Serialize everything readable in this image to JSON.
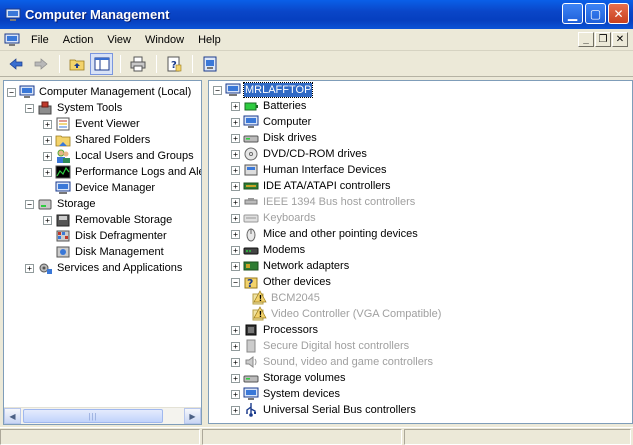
{
  "window": {
    "title": "Computer Management",
    "app_icon": "computer-management-icon",
    "controls": [
      "minimize",
      "maximize",
      "close"
    ]
  },
  "menubar": {
    "items": [
      "File",
      "Action",
      "View",
      "Window",
      "Help"
    ]
  },
  "toolbar": {
    "buttons": [
      "back-icon",
      "forward-icon",
      "up-folder-icon",
      "show-hide-tree-icon",
      "print-icon",
      "help-icon",
      "properties-icon"
    ]
  },
  "left_tree": [
    {
      "label": "Computer Management (Local)",
      "level": 0,
      "expander": "minus",
      "icon": "computer-management-icon"
    },
    {
      "label": "System Tools",
      "level": 1,
      "expander": "minus",
      "icon": "system-tools-icon"
    },
    {
      "label": "Event Viewer",
      "level": 2,
      "expander": "plus",
      "icon": "event-viewer-icon"
    },
    {
      "label": "Shared Folders",
      "level": 2,
      "expander": "plus",
      "icon": "shared-folders-icon"
    },
    {
      "label": "Local Users and Groups",
      "level": 2,
      "expander": "plus",
      "icon": "users-icon"
    },
    {
      "label": "Performance Logs and Alerts",
      "level": 2,
      "expander": "plus",
      "icon": "performance-icon"
    },
    {
      "label": "Device Manager",
      "level": 2,
      "expander": "none",
      "icon": "device-manager-icon"
    },
    {
      "label": "Storage",
      "level": 1,
      "expander": "minus",
      "icon": "storage-icon"
    },
    {
      "label": "Removable Storage",
      "level": 2,
      "expander": "plus",
      "icon": "removable-storage-icon"
    },
    {
      "label": "Disk Defragmenter",
      "level": 2,
      "expander": "none",
      "icon": "defrag-icon"
    },
    {
      "label": "Disk Management",
      "level": 2,
      "expander": "none",
      "icon": "disk-management-icon"
    },
    {
      "label": "Services and Applications",
      "level": 1,
      "expander": "plus",
      "icon": "services-icon"
    }
  ],
  "right_tree": {
    "root": "MRLAFFTOP",
    "items": [
      {
        "label": "Batteries",
        "icon": "battery-icon",
        "expander": "plus",
        "disabled": false
      },
      {
        "label": "Computer",
        "icon": "computer-icon",
        "expander": "plus",
        "disabled": false
      },
      {
        "label": "Disk drives",
        "icon": "disk-drive-icon",
        "expander": "plus",
        "disabled": false
      },
      {
        "label": "DVD/CD-ROM drives",
        "icon": "cdrom-icon",
        "expander": "plus",
        "disabled": false
      },
      {
        "label": "Human Interface Devices",
        "icon": "hid-icon",
        "expander": "plus",
        "disabled": false
      },
      {
        "label": "IDE ATA/ATAPI controllers",
        "icon": "ide-icon",
        "expander": "plus",
        "disabled": false
      },
      {
        "label": "IEEE 1394 Bus host controllers",
        "icon": "ieee1394-icon",
        "expander": "plus",
        "disabled": true
      },
      {
        "label": "Keyboards",
        "icon": "keyboard-icon",
        "expander": "plus",
        "disabled": true
      },
      {
        "label": "Mice and other pointing devices",
        "icon": "mouse-icon",
        "expander": "plus",
        "disabled": false
      },
      {
        "label": "Modems",
        "icon": "modem-icon",
        "expander": "plus",
        "disabled": false
      },
      {
        "label": "Network adapters",
        "icon": "network-adapter-icon",
        "expander": "plus",
        "disabled": false
      },
      {
        "label": "Other devices",
        "icon": "unknown-device-icon",
        "expander": "minus",
        "disabled": false
      },
      {
        "label": "BCM2045",
        "icon": "warning-device-icon",
        "expander": "child",
        "disabled": true
      },
      {
        "label": "Video Controller (VGA Compatible)",
        "icon": "warning-device-icon",
        "expander": "child",
        "disabled": true
      },
      {
        "label": "Processors",
        "icon": "processor-icon",
        "expander": "plus",
        "disabled": false
      },
      {
        "label": "Secure Digital host controllers",
        "icon": "sd-icon",
        "expander": "plus",
        "disabled": true
      },
      {
        "label": "Sound, video and game controllers",
        "icon": "sound-icon",
        "expander": "plus",
        "disabled": true
      },
      {
        "label": "Storage volumes",
        "icon": "storage-volume-icon",
        "expander": "plus",
        "disabled": false
      },
      {
        "label": "System devices",
        "icon": "system-device-icon",
        "expander": "plus",
        "disabled": false
      },
      {
        "label": "Universal Serial Bus controllers",
        "icon": "usb-icon",
        "expander": "plus",
        "disabled": false
      }
    ]
  },
  "colors": {
    "titlebar": "#0A46C8",
    "selection": "#316AC5",
    "disabled_text": "#A0A0A0",
    "pane_border": "#7F9DB9"
  }
}
